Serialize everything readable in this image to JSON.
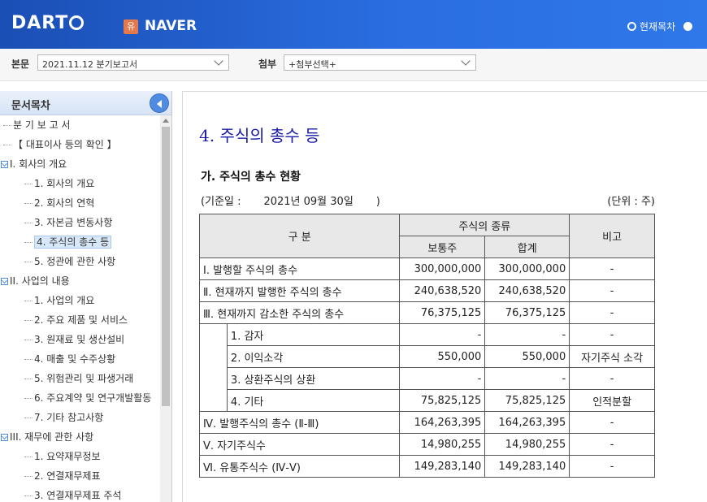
{
  "header": {
    "logo": "DART",
    "company_badge": "유",
    "company_name": "NAVER",
    "radio_current_label": "현재목차"
  },
  "toolbar": {
    "report_label": "본문",
    "report_value": "2021.11.12  분기보고서",
    "attach_label": "첨부",
    "attach_value": "+첨부선택+"
  },
  "sidebar": {
    "title": "문서목차",
    "items": [
      {
        "label": "분 기 보 고 서"
      },
      {
        "label": "【 대표이사 등의 확인 】"
      },
      {
        "label": "I. 회사의 개요"
      },
      {
        "label": "1. 회사의 개요"
      },
      {
        "label": "2. 회사의 연혁"
      },
      {
        "label": "3. 자본금 변동사항"
      },
      {
        "label": "4. 주식의 총수 등"
      },
      {
        "label": "5. 정관에 관한 사항"
      },
      {
        "label": "II. 사업의 내용"
      },
      {
        "label": "1. 사업의 개요"
      },
      {
        "label": "2. 주요 제품 및 서비스"
      },
      {
        "label": "3. 원재료 및 생산설비"
      },
      {
        "label": "4. 매출 및 수주상황"
      },
      {
        "label": "5. 위험관리 및 파생거래"
      },
      {
        "label": "6. 주요계약 및 연구개발활동"
      },
      {
        "label": "7. 기타 참고사항"
      },
      {
        "label": "III. 재무에 관한 사항"
      },
      {
        "label": "1. 요약재무정보"
      },
      {
        "label": "2. 연결재무제표"
      },
      {
        "label": "3. 연결재무제표 주석"
      }
    ]
  },
  "content": {
    "section_title": "4. 주식의 총수 등",
    "sub_title": "가. 주식의 총수 현황",
    "date_open": "(기준일 :",
    "date_value": "2021년 09월 30일",
    "date_close": ")",
    "unit": "(단위 : 주)",
    "table": {
      "header_category": "구  분",
      "header_stock_type": "주식의 종류",
      "header_common": "보통주",
      "header_total": "합계",
      "header_note": "비고",
      "rows": [
        {
          "label": "Ⅰ. 발행할 주식의 총수",
          "common": "300,000,000",
          "total": "300,000,000",
          "note": "-"
        },
        {
          "label": "Ⅱ. 현재까지 발행한 주식의 총수",
          "common": "240,638,520",
          "total": "240,638,520",
          "note": "-"
        },
        {
          "label": "Ⅲ. 현재까지 감소한 주식의 총수",
          "common": "76,375,125",
          "total": "76,375,125",
          "note": "-"
        },
        {
          "label": "1. 감자",
          "common": "-",
          "total": "-",
          "note": "-"
        },
        {
          "label": "2. 이익소각",
          "common": "550,000",
          "total": "550,000",
          "note": "자기주식 소각"
        },
        {
          "label": "3. 상환주식의 상환",
          "common": "-",
          "total": "-",
          "note": "-"
        },
        {
          "label": "4. 기타",
          "common": "75,825,125",
          "total": "75,825,125",
          "note": "인적분할"
        },
        {
          "label": "Ⅳ. 발행주식의 총수 (Ⅱ-Ⅲ)",
          "common": "164,263,395",
          "total": "164,263,395",
          "note": "-"
        },
        {
          "label": "Ⅴ. 자기주식수",
          "common": "14,980,255",
          "total": "14,980,255",
          "note": "-"
        },
        {
          "label": "Ⅵ. 유통주식수 (Ⅳ-Ⅴ)",
          "common": "149,283,140",
          "total": "149,283,140",
          "note": "-"
        }
      ]
    }
  }
}
